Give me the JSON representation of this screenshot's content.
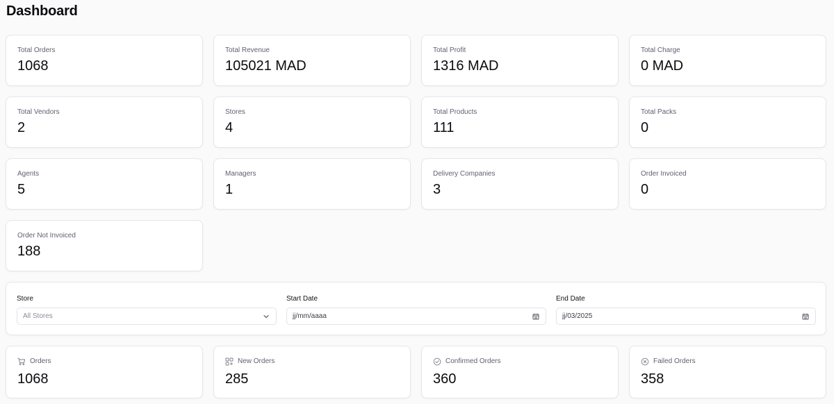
{
  "page": {
    "title": "Dashboard"
  },
  "stats": [
    {
      "label": "Total Orders",
      "value": "1068"
    },
    {
      "label": "Total Revenue",
      "value": "105021 MAD"
    },
    {
      "label": "Total Profit",
      "value": "1316 MAD"
    },
    {
      "label": "Total Charge",
      "value": "0 MAD"
    },
    {
      "label": "Total Vendors",
      "value": "2"
    },
    {
      "label": "Stores",
      "value": "4"
    },
    {
      "label": "Total Products",
      "value": "111"
    },
    {
      "label": "Total Packs",
      "value": "0"
    },
    {
      "label": "Agents",
      "value": "5"
    },
    {
      "label": "Managers",
      "value": "1"
    },
    {
      "label": "Delivery Companies",
      "value": "3"
    },
    {
      "label": "Order Invoiced",
      "value": "0"
    },
    {
      "label": "Order Not Invoiced",
      "value": "188"
    }
  ],
  "filters": {
    "store": {
      "label": "Store",
      "value": "All Stores",
      "icon": "chevron-down-icon"
    },
    "start_date": {
      "label": "Start Date",
      "value": "jj/mm/aaaa",
      "icon": "calendar-icon"
    },
    "end_date": {
      "label": "End Date",
      "value": "jj/03/2025",
      "icon": "calendar-icon"
    }
  },
  "metrics": [
    {
      "label": "Orders",
      "value": "1068",
      "icon": "cart-icon"
    },
    {
      "label": "New Orders",
      "value": "285",
      "icon": "grid-plus-icon"
    },
    {
      "label": "Confirmed Orders",
      "value": "360",
      "icon": "check-circle-icon"
    },
    {
      "label": "Failed Orders",
      "value": "358",
      "icon": "x-circle-icon"
    }
  ]
}
